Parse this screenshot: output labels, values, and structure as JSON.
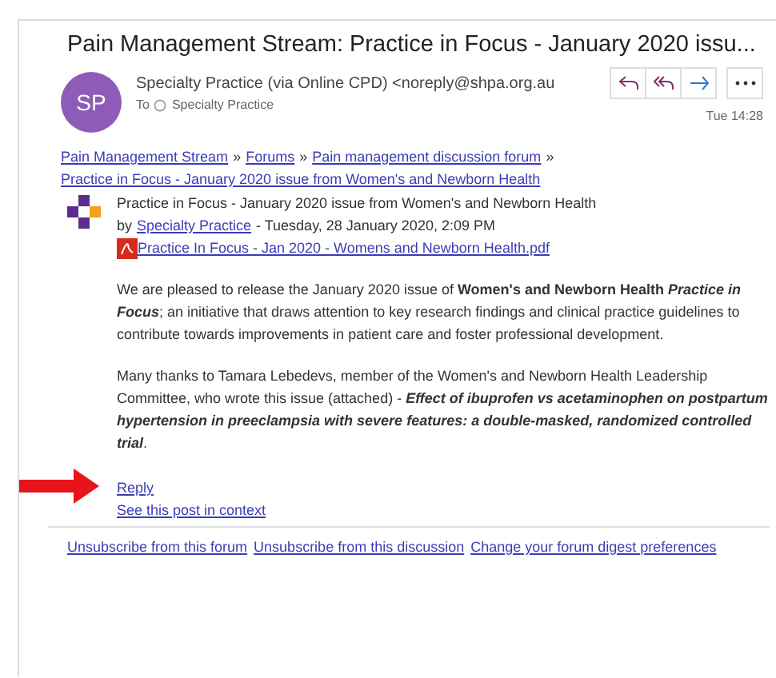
{
  "email": {
    "subject": "Pain Management Stream: Practice in Focus - January 2020 issu...",
    "sender": {
      "initials": "SP",
      "name": "Specialty Practice (via Online CPD) <noreply@shpa.org.au",
      "to_label": "To",
      "recipient": "Specialty Practice",
      "time": "Tue 14:28"
    },
    "actions": [
      {
        "kind": "reply"
      },
      {
        "kind": "reply_all"
      },
      {
        "kind": "forward"
      },
      {
        "kind": "more"
      }
    ]
  },
  "breadcrumb": [
    {
      "label": "Pain Management Stream"
    },
    {
      "label": "Forums"
    },
    {
      "label": "Pain management discussion forum"
    },
    {
      "label": "Practice in Focus - January 2020 issue from Women's and Newborn Health"
    }
  ],
  "breadcrumb_separator": "»",
  "post": {
    "title": "Practice in Focus - January 2020 issue from Women's and Newborn Health",
    "by_label": "by",
    "author": "Specialty Practice",
    "date": "- Tuesday, 28 January 2020, 2:09 PM",
    "attachment": "Practice In Focus - Jan 2020 - Womens and Newborn Health.pdf",
    "paragraphs": [
      "We are pleased to release the January 2020 issue of **Women's and Newborn Health** *Practice in Focus*; an initiative that draws attention to key research findings and clinical practice guidelines to contribute towards improvements in patient care and foster professional development.",
      "Many thanks to Tamara Lebedevs, member of the Women's and Newborn Health Leadership Committee, who wrote this issue (attached) - *Effect of ibuprofen vs acetaminophen on postpartum hypertension in preeclampsia with severe features: a double-masked, randomized controlled trial*."
    ],
    "links": [
      "Reply",
      "See this post in context"
    ]
  },
  "footer_links": [
    "Unsubscribe from this forum",
    "Unsubscribe from this discussion",
    "Change your forum digest preferences"
  ]
}
